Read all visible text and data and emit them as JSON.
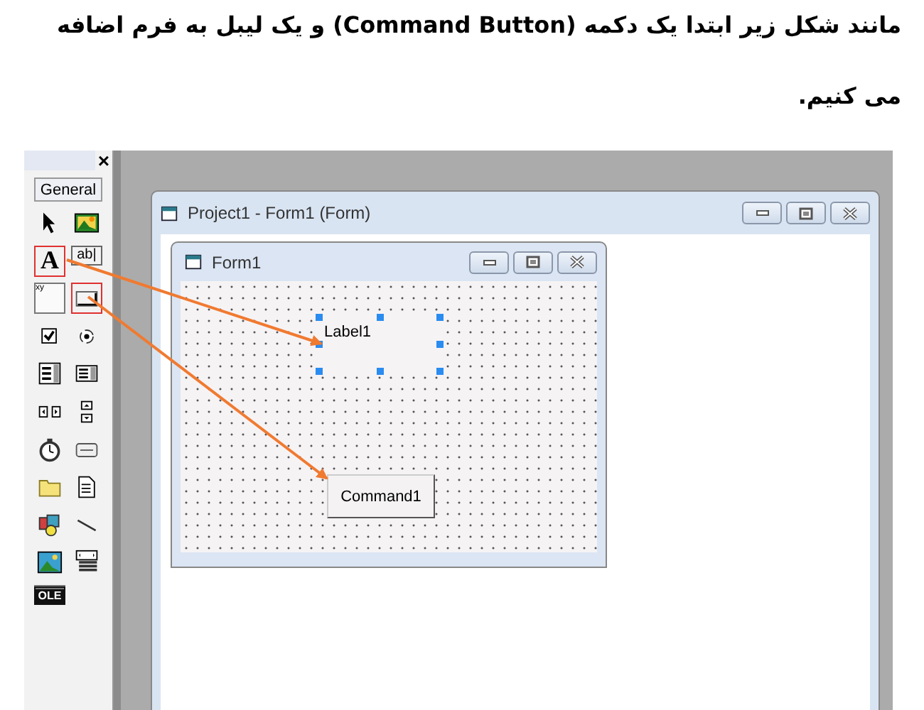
{
  "instruction": {
    "lines": [
      "مانند شکل زیر ابتدا یک دکمه  (Command Button) و یک لیبل به فرم اضافه",
      "می کنیم."
    ]
  },
  "toolbox": {
    "close": "×",
    "tab": "General",
    "tools": [
      {
        "kind": "pointer",
        "highlighted": false
      },
      {
        "kind": "picture",
        "highlighted": false
      },
      {
        "kind": "label",
        "text": "A",
        "highlighted": true
      },
      {
        "kind": "textbox",
        "text": "ab|",
        "highlighted": false
      },
      {
        "kind": "frame",
        "text": "xy",
        "highlighted": false
      },
      {
        "kind": "command",
        "highlighted": true
      },
      {
        "kind": "checkbox",
        "highlighted": false
      },
      {
        "kind": "option",
        "highlighted": false
      },
      {
        "kind": "combobox",
        "highlighted": false
      },
      {
        "kind": "listbox",
        "highlighted": false
      },
      {
        "kind": "hscroll",
        "highlighted": false
      },
      {
        "kind": "vscroll",
        "highlighted": false
      },
      {
        "kind": "timer",
        "highlighted": false
      },
      {
        "kind": "drive",
        "highlighted": false
      },
      {
        "kind": "folder",
        "highlighted": false
      },
      {
        "kind": "file",
        "highlighted": false
      },
      {
        "kind": "shape",
        "highlighted": false
      },
      {
        "kind": "line",
        "highlighted": false
      },
      {
        "kind": "image",
        "highlighted": false
      },
      {
        "kind": "data",
        "highlighted": false
      },
      {
        "kind": "ole",
        "text": "OLE",
        "highlighted": false
      }
    ]
  },
  "project_window": {
    "title": "Project1 - Form1 (Form)"
  },
  "form_window": {
    "title": "Form1",
    "controls": [
      {
        "kind": "label",
        "text": "Label1",
        "selected": true
      },
      {
        "kind": "button",
        "text": "Command1",
        "selected": false
      }
    ]
  }
}
